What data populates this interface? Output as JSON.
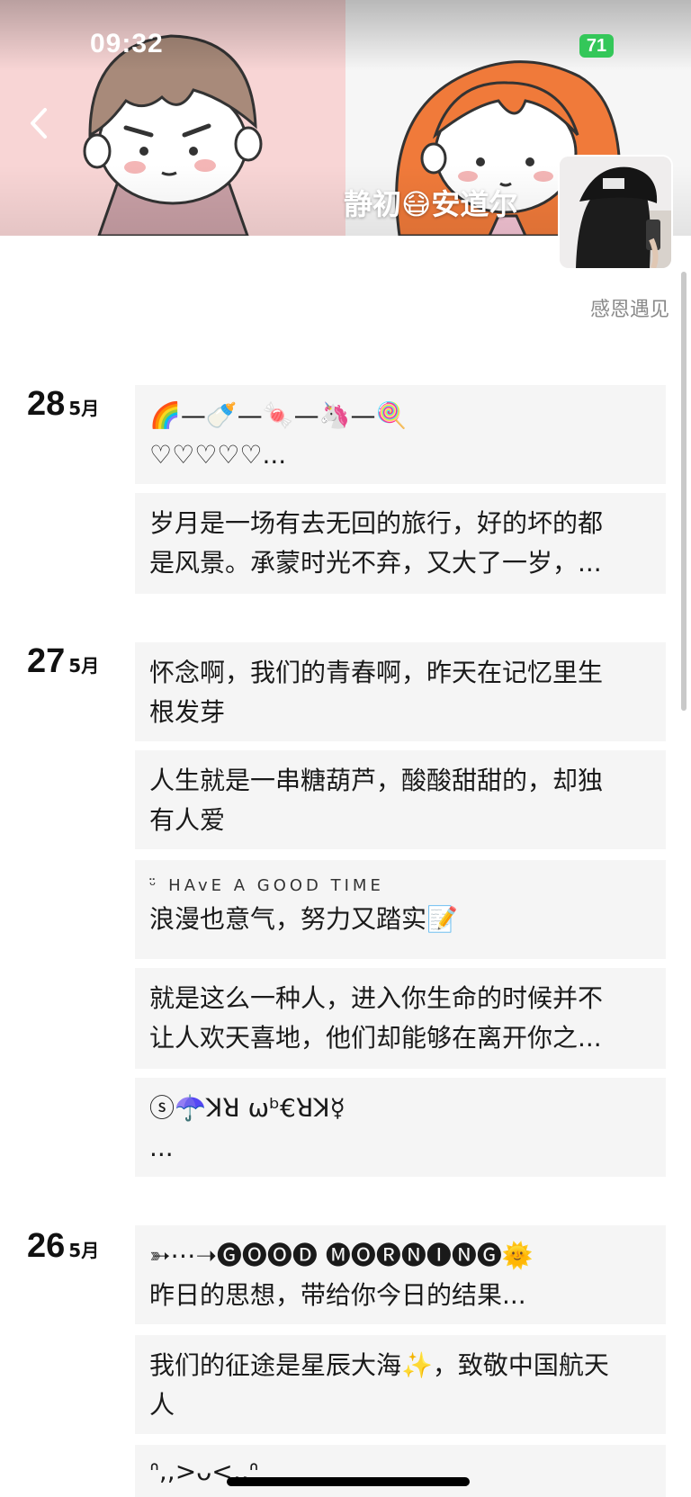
{
  "status_bar": {
    "time": "09:32",
    "battery": "71"
  },
  "profile": {
    "name": "静初😷安道尔",
    "signature": "感恩遇见"
  },
  "colors": {
    "cover_left": "#f8d5d5",
    "post_bg": "#f5f5f5",
    "battery": "#34c759"
  },
  "icons": {
    "back": "chevron-left-icon"
  },
  "groups": [
    {
      "day": "28",
      "month": "5月",
      "posts": [
        {
          "lines": [
            "🌈—🍼—🍬—🦄—🍭",
            "♡♡♡♡♡..."
          ]
        },
        {
          "lines": [
            "岁月是一场有去无回的旅行，好的坏的都",
            "是风景。承蒙时光不弃，又大了一岁，..."
          ]
        }
      ]
    },
    {
      "day": "27",
      "month": "5月",
      "posts": [
        {
          "lines": [
            "怀念啊，我们的青春啊，昨天在记忆里生",
            "根发芽"
          ]
        },
        {
          "lines": [
            "人生就是一串糖葫芦，酸酸甜甜的，却独",
            "有人爱"
          ]
        },
        {
          "lines": [
            "ᵕ̈ HAvE A GOOD TIME",
            "浪漫也意气，努力又踏实📝"
          ]
        },
        {
          "lines": [
            "就是这么一种人，进入你生命的时候并不",
            "让人欢天喜地，他们却能够在离开你之..."
          ]
        },
        {
          "lines": [
            "ⓢ☂️ꓘꓤ ωᵇ€ꓤꓘ☿",
            "..."
          ]
        }
      ]
    },
    {
      "day": "26",
      "month": "5月",
      "posts": [
        {
          "lines": [
            "➳⋯➝🅖🅞🅞🅓 🅜🅞🅡🅝🅘🅝🅖🌞",
            "昨日的思想，带给你今日的结果..."
          ]
        },
        {
          "lines": [
            "我们的征途是星辰大海✨，致敬中国航天",
            "人"
          ]
        },
        {
          "lines": [
            "ᐢ,,>ᴗ<,,ᐢ"
          ]
        }
      ]
    }
  ]
}
